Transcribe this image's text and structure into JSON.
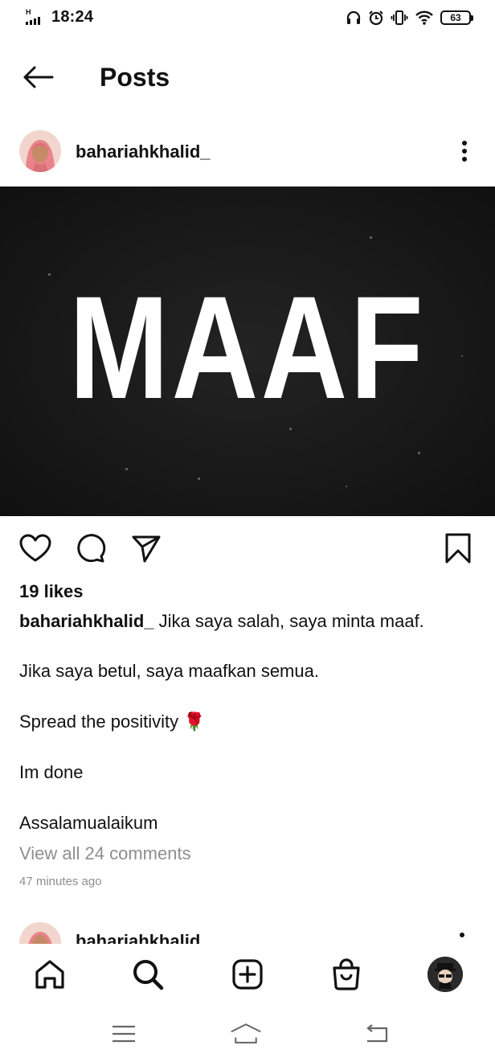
{
  "status_bar": {
    "network": "H",
    "time": "18:24",
    "battery": "63",
    "icons": [
      "headphones-icon",
      "alarm-icon",
      "vibrate-icon",
      "wifi-icon",
      "battery-icon"
    ]
  },
  "header": {
    "back_icon": "arrow-left-icon",
    "title": "Posts"
  },
  "post": {
    "username": "bahariahkhalid_",
    "image_text": "MAAF",
    "likes": "19 likes",
    "caption_user": "bahariahkhalid_",
    "caption_first": "Jika saya salah, saya minta maaf.",
    "caption_lines": [
      "Jika saya betul, saya maafkan semua.",
      "Spread the positivity 🌹",
      "Im done",
      "Assalamualaikum"
    ],
    "view_comments": "View all 24 comments",
    "time_ago": "47 minutes ago",
    "action_icons": [
      "heart-icon",
      "comment-icon",
      "send-icon",
      "bookmark-icon"
    ]
  },
  "next_post": {
    "username": "bahariahkhalid"
  },
  "bottom_nav": {
    "items": [
      "home-icon",
      "search-icon",
      "create-icon",
      "shop-icon",
      "profile-avatar"
    ]
  },
  "system_nav": {
    "items": [
      "menu-icon",
      "home-icon",
      "back-icon"
    ]
  }
}
